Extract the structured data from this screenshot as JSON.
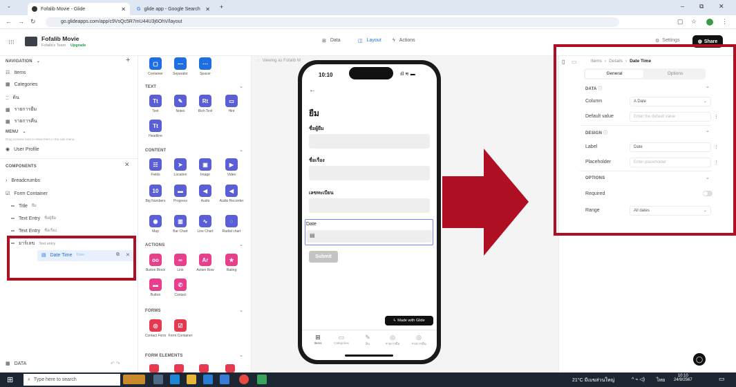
{
  "browser": {
    "tabs": [
      {
        "label": "Fofalib Movie - Glide",
        "active": true
      },
      {
        "label": "glide app - Google Search",
        "active": false
      }
    ],
    "url": "go.glideapps.com/app/c9VsQc5R7mU44U3j6OhV/layout",
    "window_controls": [
      "–",
      "⧉",
      "✕"
    ]
  },
  "app": {
    "name": "Fofalib Movie",
    "team": "Fofalib's Team",
    "upgrade": "Upgrade",
    "top_tabs": [
      "Data",
      "Layout",
      "Actions"
    ],
    "settings": "Settings",
    "share": "Share"
  },
  "left": {
    "navigation_header": "NAVIGATION",
    "nav_items": [
      "Items",
      "Categories",
      "ดิน",
      "รายการยืม",
      "รายการคืน"
    ],
    "menu_header": "MENU",
    "menu_hint": "Drag screens here to show them in the side menu.",
    "menu_items": [
      "User Profile"
    ],
    "components_header": "COMPONENTS",
    "components": [
      {
        "label": "Breadcrumbs",
        "sub": ""
      },
      {
        "label": "Form Container",
        "sub": ""
      },
      {
        "label": "Title",
        "sub": "ยืม"
      },
      {
        "label": "Text Entry",
        "sub": "ชื่อผู้ยืม"
      },
      {
        "label": "Text Entry",
        "sub": "ชื่อเรื่อง"
      },
      {
        "label": "ยาร์เลข",
        "sub": "Text entry"
      },
      {
        "label": "Date Time",
        "sub": "Date"
      }
    ],
    "data_footer": "DATA"
  },
  "components_panel": {
    "layout_tiles": [
      "Container",
      "Separator",
      "Spacer"
    ],
    "text_header": "TEXT",
    "text_tiles": [
      "Text",
      "Notes",
      "Rich Text",
      "Hint",
      "Headline"
    ],
    "content_header": "CONTENT",
    "content_tiles": [
      "Fields",
      "Location",
      "Image",
      "Video",
      "Big Numbers",
      "Progress",
      "Audio",
      "Audio Recorder",
      "Map",
      "Bar Chart",
      "Line Chart",
      "Radial chart"
    ],
    "actions_header": "ACTIONS",
    "action_tiles": [
      "Button Block",
      "Link",
      "Action Row",
      "Rating",
      "Button",
      "Contact"
    ],
    "forms_header": "FORMS",
    "form_tiles": [
      "Contact Form",
      "Form Container"
    ],
    "form_elements_header": "FORM ELEMENTS"
  },
  "canvas": {
    "viewing_as": "Viewing as Fofalib M",
    "phone": {
      "time": "10:10",
      "title": "ยืม",
      "labels": [
        "ชื่อผู้ยืม",
        "ชื่อเรื่อง",
        "เลขทะเบียน"
      ],
      "date_label": "Date",
      "submit": "Submit",
      "made_with": "Made with Glide",
      "tabs": [
        "Items",
        "Categories",
        "ดิน",
        "รายการยืม",
        "รายการคืน"
      ]
    }
  },
  "right": {
    "breadcrumb": [
      "Items",
      "Details",
      "Date Time"
    ],
    "tabs": [
      "General",
      "Options"
    ],
    "data_header": "DATA",
    "column_label": "Column",
    "column_value": "A  Date",
    "default_label": "Default value",
    "default_placeholder": "Enter the default value",
    "design_header": "DESIGN",
    "label_label": "Label",
    "label_value": "Date",
    "placeholder_label": "Placeholder",
    "placeholder_placeholder": "Enter placeholder",
    "options_header": "OPTIONS",
    "required_label": "Required",
    "range_label": "Range",
    "range_value": "All dates"
  },
  "taskbar": {
    "search_placeholder": "Type here to search",
    "weather": "21°C มีเมฆส่วนใหญ่",
    "lang": "ไทย",
    "time": "10:10",
    "date": "24/9/2567"
  },
  "colors": {
    "highlight": "#b00f23",
    "accent": "#1f6fe3"
  }
}
